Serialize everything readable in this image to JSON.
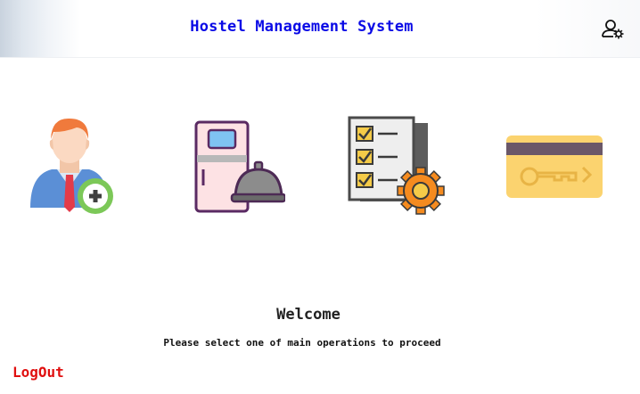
{
  "header": {
    "title": "Hostel Management System",
    "settings_icon": "user-settings-icon"
  },
  "tiles": [
    {
      "icon": "add-student-icon"
    },
    {
      "icon": "room-service-icon"
    },
    {
      "icon": "checklist-settings-icon"
    },
    {
      "icon": "key-card-icon"
    }
  ],
  "main": {
    "welcome": "Welcome",
    "instruction": "Please select one of main operations to proceed"
  },
  "footer": {
    "logout_label": "LogOut"
  },
  "colors": {
    "title": "#0a0ae6",
    "logout": "#e01010"
  }
}
